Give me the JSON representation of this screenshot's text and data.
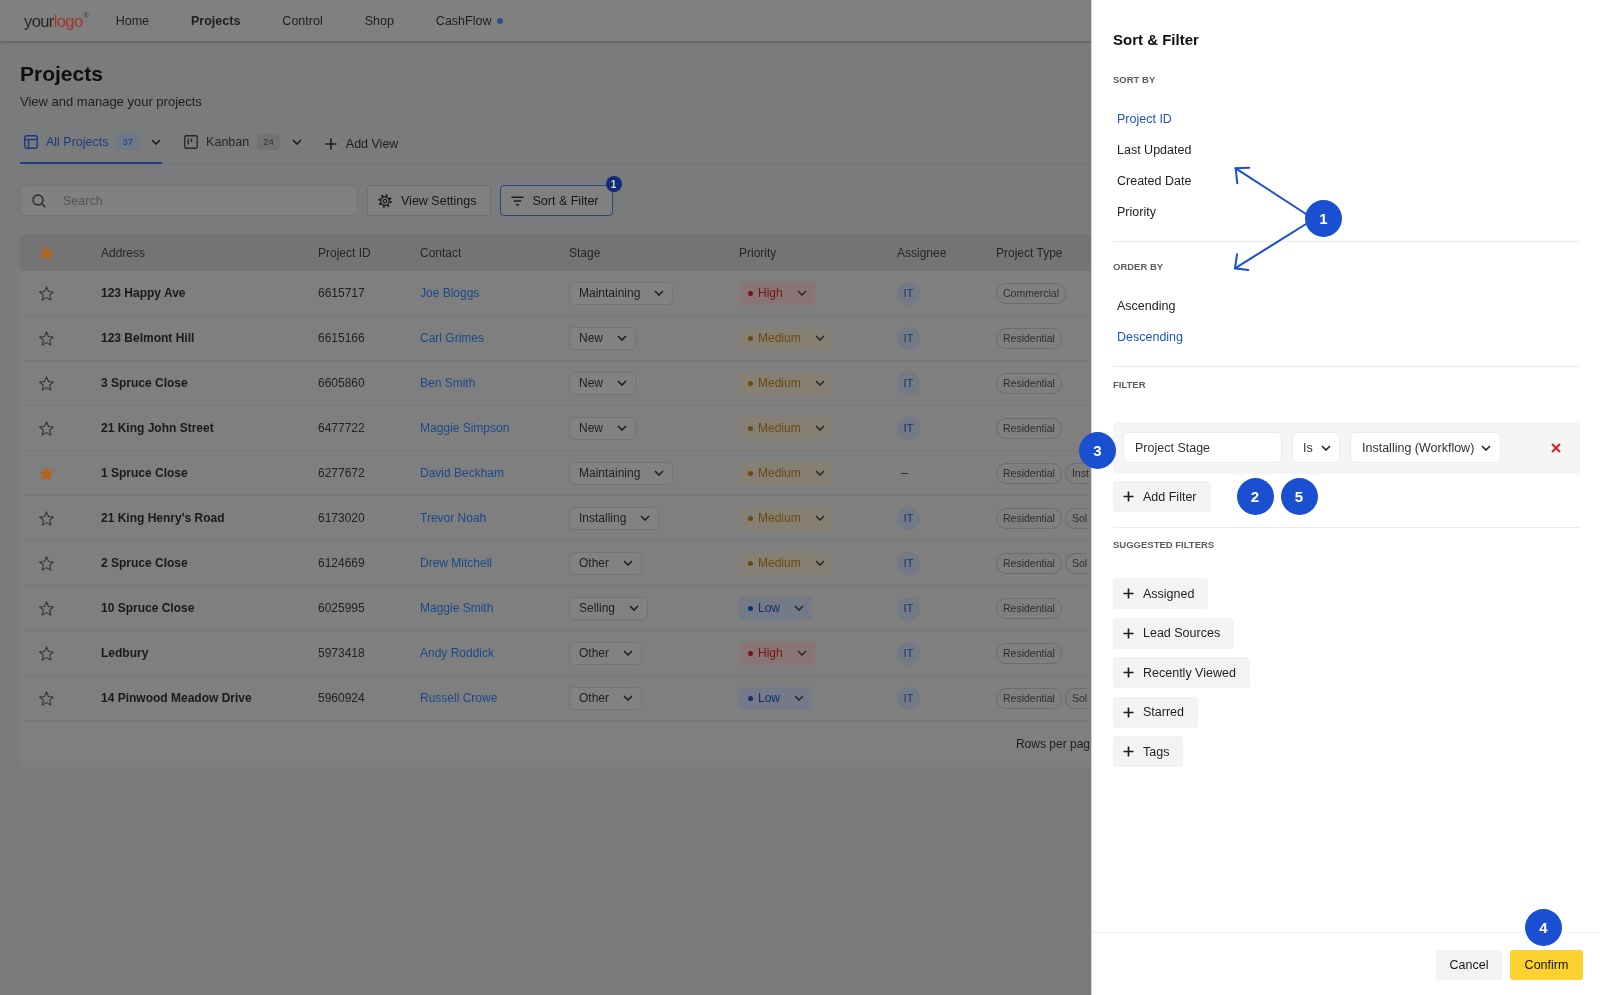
{
  "nav": {
    "logo": {
      "text": "your",
      "accent": "logo",
      "mark": "®"
    },
    "items": [
      {
        "label": "Home",
        "selected": false,
        "dot": false
      },
      {
        "label": "Projects",
        "selected": true,
        "dot": false
      },
      {
        "label": "Control",
        "selected": false,
        "dot": false
      },
      {
        "label": "Shop",
        "selected": false,
        "dot": false
      },
      {
        "label": "CashFlow",
        "selected": false,
        "dot": true
      }
    ]
  },
  "page": {
    "title": "Projects",
    "subtitle": "View and manage your projects"
  },
  "views": {
    "tabs": [
      {
        "kind": "table",
        "label": "All Projects",
        "count": "37",
        "selected": true
      },
      {
        "kind": "board",
        "label": "Kanban",
        "count": "24",
        "selected": false
      }
    ],
    "add_view": "Add View"
  },
  "toolbar": {
    "search": {
      "placeholder": "Search"
    },
    "view_settings": "View Settings",
    "sort_filter": {
      "label": "Sort & Filter",
      "badge": "1",
      "active": true
    }
  },
  "table": {
    "columns": [
      "Address",
      "Project ID",
      "Contact",
      "Stage",
      "Priority",
      "Assignee",
      "Project Type"
    ],
    "rows": [
      {
        "starred": false,
        "address": "123 Happy Ave",
        "project_id": "6615717",
        "contact": "Joe Bloggs",
        "stage": "Maintaining",
        "priority": {
          "text": "High",
          "color": "#7a1414"
        },
        "assignee": {
          "kind": "avatar",
          "text": "IT"
        },
        "project_types": [
          "Commercial"
        ]
      },
      {
        "starred": false,
        "address": "123 Belmont Hill",
        "project_id": "6615166",
        "contact": "Carl Grimes",
        "stage": "New",
        "priority": {
          "text": "Medium",
          "color": "#6b4a10"
        },
        "assignee": {
          "kind": "avatar",
          "text": "IT"
        },
        "project_types": [
          "Residential"
        ]
      },
      {
        "starred": false,
        "address": "3 Spruce Close",
        "project_id": "6605860",
        "contact": "Ben Smith",
        "stage": "New",
        "priority": {
          "text": "Medium",
          "color": "#6b4a10"
        },
        "assignee": {
          "kind": "avatar",
          "text": "IT"
        },
        "project_types": [
          "Residential"
        ]
      },
      {
        "starred": false,
        "address": "21 King John Street",
        "project_id": "6477722",
        "contact": "Maggie Simpson",
        "stage": "New",
        "priority": {
          "text": "Medium",
          "color": "#6b4a10"
        },
        "assignee": {
          "kind": "avatar",
          "text": "IT"
        },
        "project_types": [
          "Residential"
        ]
      },
      {
        "starred": true,
        "address": "1 Spruce Close",
        "project_id": "6277672",
        "contact": "David Beckham",
        "stage": "Maintaining",
        "priority": {
          "text": "Medium",
          "color": "#6b4a10"
        },
        "assignee": {
          "kind": "empty",
          "text": "–"
        },
        "project_types": [
          "Residential",
          "Inst"
        ]
      },
      {
        "starred": false,
        "address": "21 King Henry's Road",
        "project_id": "6173020",
        "contact": "Trevor Noah",
        "stage": "Installing",
        "priority": {
          "text": "Medium",
          "color": "#6b4a10"
        },
        "assignee": {
          "kind": "avatar",
          "text": "IT"
        },
        "project_types": [
          "Residential",
          "Sol"
        ]
      },
      {
        "starred": false,
        "address": "2 Spruce Close",
        "project_id": "6124669",
        "contact": "Drew Mitchell",
        "stage": "Other",
        "priority": {
          "text": "Medium",
          "color": "#6b4a10"
        },
        "assignee": {
          "kind": "avatar",
          "text": "IT"
        },
        "project_types": [
          "Residential",
          "Sol"
        ]
      },
      {
        "starred": false,
        "address": "10 Spruce Close",
        "project_id": "6025995",
        "contact": "Maggie Smith",
        "stage": "Selling",
        "priority": {
          "text": "Low",
          "color": "#12306e"
        },
        "assignee": {
          "kind": "avatar",
          "text": "IT"
        },
        "project_types": [
          "Residential"
        ]
      },
      {
        "starred": false,
        "address": "Ledbury",
        "project_id": "5973418",
        "contact": "Andy Roddick",
        "stage": "Other",
        "priority": {
          "text": "High",
          "color": "#7a1414"
        },
        "assignee": {
          "kind": "avatar",
          "text": "IT"
        },
        "project_types": [
          "Residential"
        ]
      },
      {
        "starred": false,
        "address": "14 Pinwood Meadow Drive",
        "project_id": "5960924",
        "contact": "Russell Crowe",
        "stage": "Other",
        "priority": {
          "text": "Low",
          "color": "#12306e"
        },
        "assignee": {
          "kind": "avatar",
          "text": "IT"
        },
        "project_types": [
          "Residential",
          "Sol"
        ]
      }
    ],
    "footer": "Rows per pag"
  },
  "sort_filter_panel": {
    "title": "Sort & Filter",
    "sort_by": {
      "heading": "SORT BY",
      "annotation": "1",
      "options": [
        {
          "label": "Project ID",
          "selected": true
        },
        {
          "label": "Last Updated",
          "selected": false
        },
        {
          "label": "Created Date",
          "selected": false
        },
        {
          "label": "Priority",
          "selected": false
        }
      ]
    },
    "order_by": {
      "heading": "ORDER BY",
      "options": [
        {
          "label": "Ascending",
          "selected": false
        },
        {
          "label": "Descending",
          "selected": true
        }
      ]
    },
    "filter": {
      "heading": "FILTER",
      "rules": [
        {
          "field": "Project Stage",
          "operator": "Is",
          "value": "Installing (Workflow)",
          "annotation": "3"
        }
      ],
      "add_button": "Add Filter",
      "add_annotations": [
        "2",
        "5"
      ]
    },
    "suggested": {
      "heading": "SUGGESTED FILTERS",
      "items": [
        "Assigned",
        "Lead Sources",
        "Recently Viewed",
        "Starred",
        "Tags"
      ]
    },
    "footer": {
      "cancel": "Cancel",
      "confirm": "Confirm",
      "confirm_annotation": "4"
    }
  }
}
